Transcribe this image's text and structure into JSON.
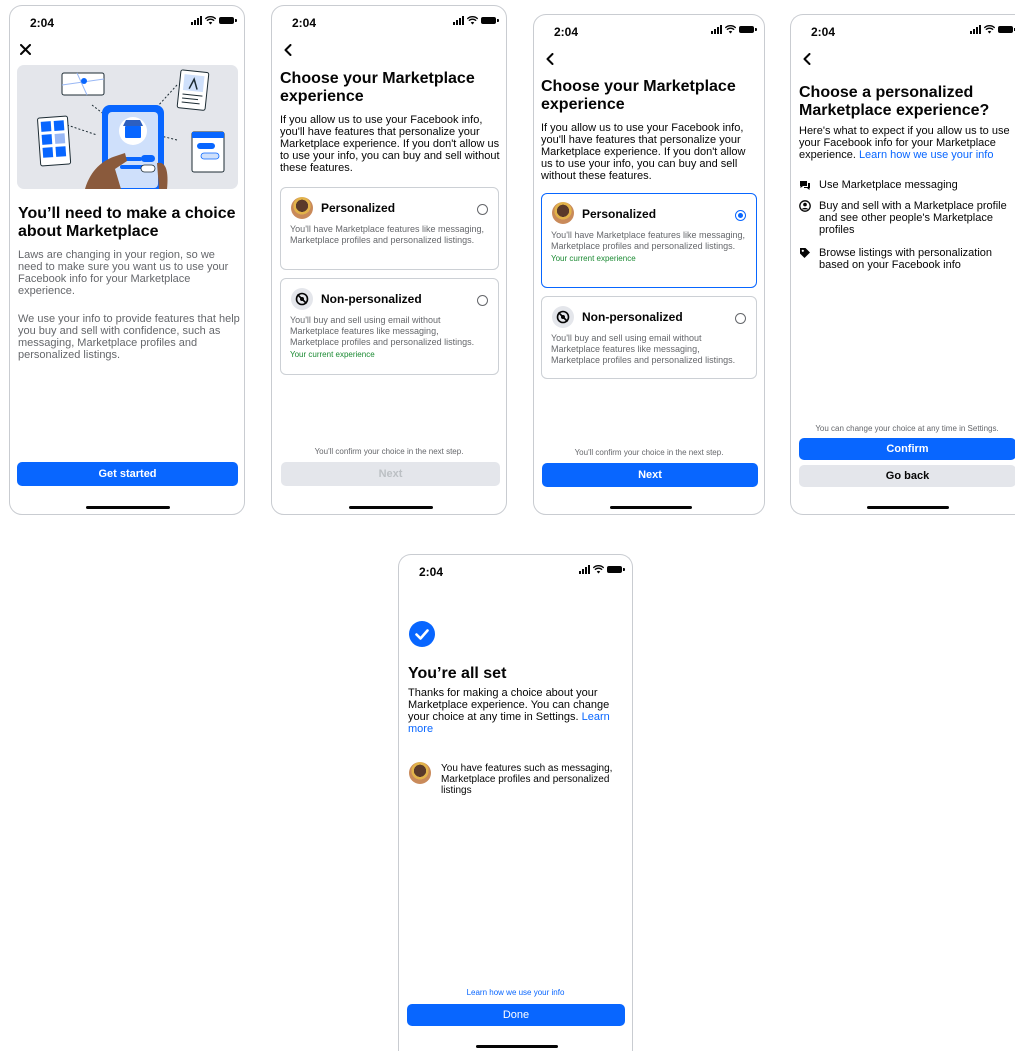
{
  "status_time": "2:04",
  "screen1": {
    "title": "You’ll need to make a choice about Marketplace",
    "para1": "Laws are changing in your region, so we need to make sure you want us to use your Facebook info for your Marketplace experience.",
    "para2": "We use your info to provide features that help you buy and sell with confidence, such as messaging, Marketplace profiles and personalized listings.",
    "button": "Get started",
    "close_icon": "close-icon"
  },
  "screen2": {
    "title": "Choose your Marketplace experience",
    "intro": "If you allow us to use your Facebook info, you'll have features that personalize your Marketplace experience. If you don't allow us to use your info, you can buy and sell without these features.",
    "personalized": {
      "title": "Personalized",
      "desc": "You'll have Marketplace features like messaging, Marketplace profiles and personalized listings."
    },
    "nonpersonalized": {
      "title": "Non-personalized",
      "desc": "You'll buy and sell using email without Marketplace features like messaging, Marketplace profiles and personalized listings.",
      "current": "Your current experience"
    },
    "note": "You'll confirm your choice in the next step.",
    "button": "Next"
  },
  "screen3": {
    "title": "Choose your Marketplace experience",
    "intro": "If you allow us to use your Facebook info, you'll have features that personalize your Marketplace experience. If you don't allow us to use your info, you can buy and sell without these features.",
    "personalized": {
      "title": "Personalized",
      "desc": "You'll have Marketplace features like messaging, Marketplace profiles and personalized listings.",
      "current": "Your current experience"
    },
    "nonpersonalized": {
      "title": "Non-personalized",
      "desc": "You'll buy and sell using email without Marketplace features like messaging, Marketplace profiles and personalized listings."
    },
    "note": "You'll confirm your choice in the next step.",
    "button": "Next"
  },
  "screen4": {
    "title": "Choose a personalized Marketplace experience?",
    "intro": "Here's what to expect if you allow us to use your Facebook info for your Marketplace experience.",
    "intro_link": "Learn how we use your info",
    "features": [
      {
        "text": "Use Marketplace messaging",
        "icon": "messaging-icon"
      },
      {
        "text": "Buy and sell with a Marketplace profile and see other people's Marketplace profiles",
        "icon": "profile-icon"
      },
      {
        "text": "Browse listings with personalization based on your Facebook info",
        "icon": "tag-icon"
      }
    ],
    "note": "You can change your choice at any time in Settings.",
    "confirm": "Confirm",
    "goback": "Go back"
  },
  "screen5": {
    "title": "You’re all set",
    "text": "Thanks for making a choice about your Marketplace experience. You can change your choice at any time in Settings.",
    "text_link": "Learn more",
    "feature": "You have features such as messaging, Marketplace profiles and personalized listings",
    "learn": "Learn how we use your info",
    "button": "Done"
  },
  "colors": {
    "accent": "#0866ff",
    "current": "#1a8a32",
    "muted": "#65676b",
    "disabled": "#e4e6eb"
  }
}
